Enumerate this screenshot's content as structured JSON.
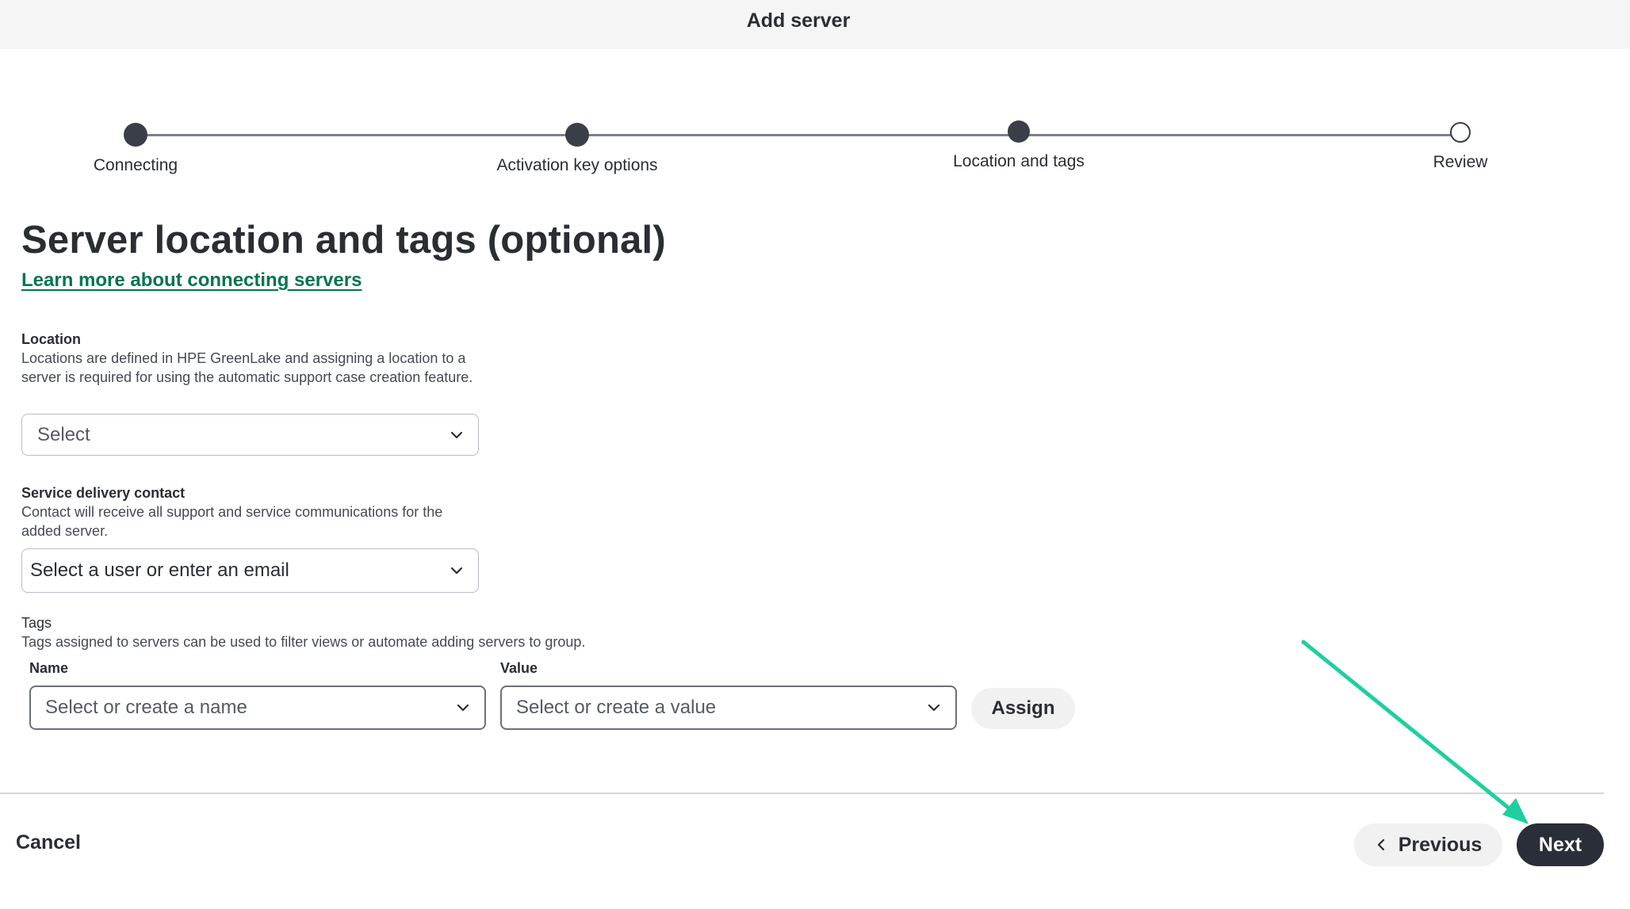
{
  "header": {
    "title": "Add server"
  },
  "stepper": {
    "steps": [
      {
        "label": "Connecting",
        "state": "completed"
      },
      {
        "label": "Activation key options",
        "state": "completed"
      },
      {
        "label": "Location and tags",
        "state": "current"
      },
      {
        "label": "Review",
        "state": "upcoming"
      }
    ]
  },
  "main": {
    "title": "Server location and tags (optional)",
    "learn_link": "Learn more about connecting servers",
    "location": {
      "label": "Location",
      "help": "Locations are defined in HPE GreenLake and assigning a location to a server is required for using the automatic support case creation feature.",
      "placeholder": "Select"
    },
    "contact": {
      "label": "Service delivery contact",
      "help": "Contact will receive all support and service communications for the added server.",
      "placeholder": "Select a user or enter an email"
    },
    "tags": {
      "label": "Tags",
      "help": "Tags assigned to servers can be used to filter views or automate adding servers to group.",
      "name_label": "Name",
      "name_placeholder": "Select or create a name",
      "value_label": "Value",
      "value_placeholder": "Select or create a value",
      "assign_label": "Assign"
    }
  },
  "footer": {
    "cancel_label": "Cancel",
    "previous_label": "Previous",
    "next_label": "Next"
  },
  "colors": {
    "link": "#01754f",
    "primary_button": "#2a2e38",
    "annotation_arrow": "#1fcf9f",
    "step_dot": "#3a3f47"
  },
  "icons": {
    "dropdown": "chevron-down-icon",
    "previous": "chevron-left-icon",
    "annotation": "arrow-icon"
  }
}
